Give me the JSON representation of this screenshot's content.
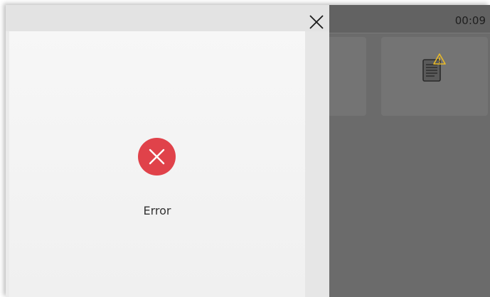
{
  "status_bar": {
    "time": "00:09"
  },
  "background_tiles": [
    {
      "icon": "blank"
    },
    {
      "icon": "document-warning-icon"
    }
  ],
  "dialog": {
    "close_icon": "close-icon",
    "status_icon": "error-circle-icon",
    "message": "Error"
  },
  "colors": {
    "error_red": "#e0424a",
    "warning_yellow": "#e8b928",
    "overlay_grey": "#6b6b6b",
    "dialog_bg": "#f4f4f4"
  }
}
